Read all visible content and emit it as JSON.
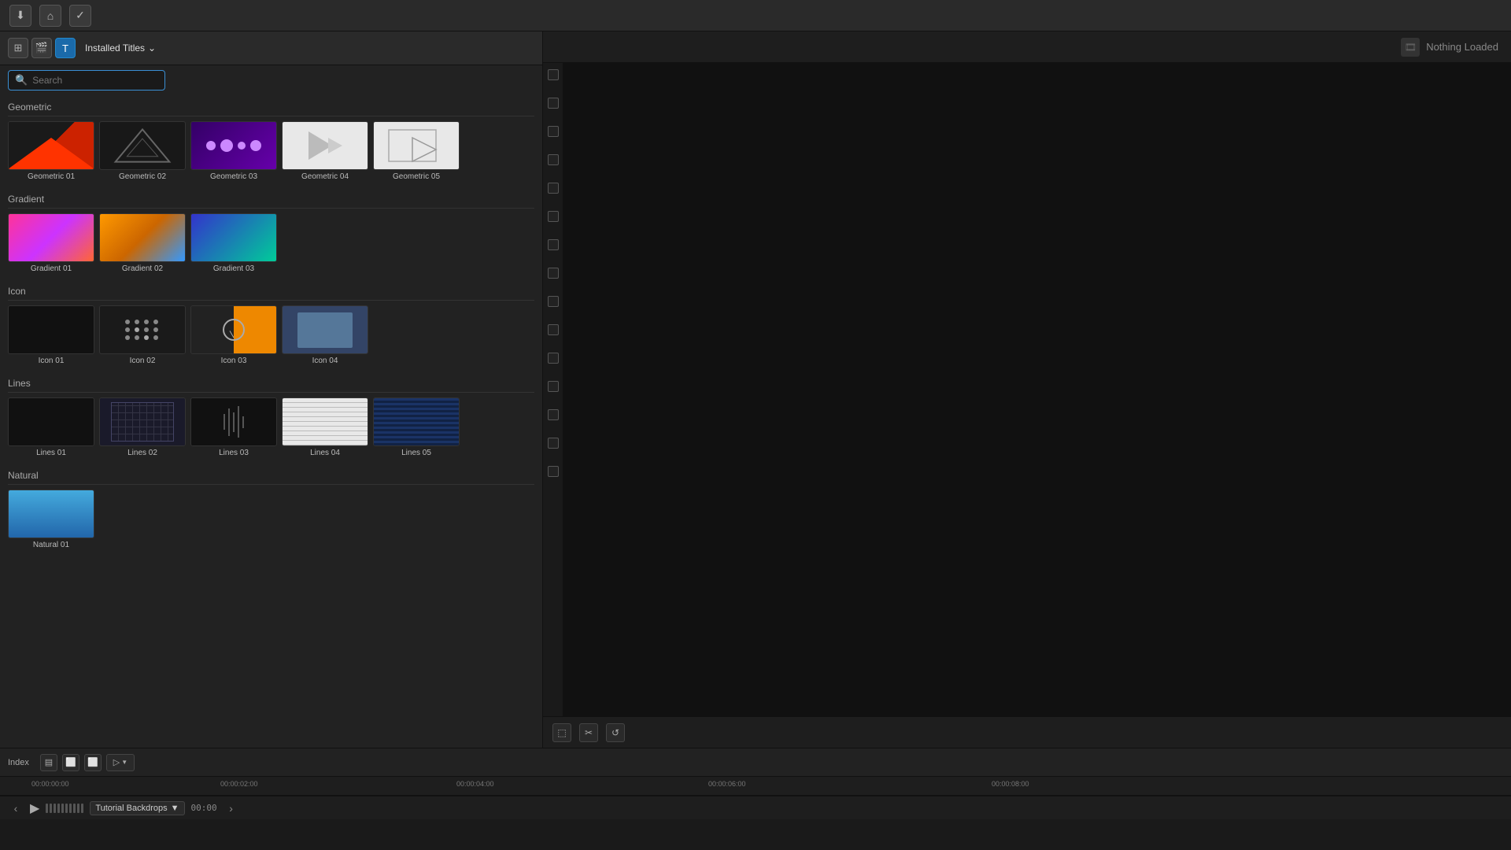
{
  "toolbar": {
    "download_label": "⬇",
    "key_label": "⌘",
    "check_label": "✓"
  },
  "panel": {
    "tab_icons": [
      "⊞",
      "🎬",
      "📁"
    ],
    "installed_titles": "Installed Titles",
    "search_placeholder": "Search"
  },
  "categories": [
    {
      "name": "Geometric",
      "items": [
        {
          "label": "Geometric 01",
          "thumb": "geo01"
        },
        {
          "label": "Geometric 02",
          "thumb": "geo02"
        },
        {
          "label": "Geometric 03",
          "thumb": "geo03"
        },
        {
          "label": "Geometric 04",
          "thumb": "geo04"
        },
        {
          "label": "Geometric 05",
          "thumb": "geo05"
        }
      ]
    },
    {
      "name": "Gradient",
      "items": [
        {
          "label": "Gradient 01",
          "thumb": "grad01"
        },
        {
          "label": "Gradient 02",
          "thumb": "grad02"
        },
        {
          "label": "Gradient 03",
          "thumb": "grad03"
        }
      ]
    },
    {
      "name": "Icon",
      "items": [
        {
          "label": "Icon 01",
          "thumb": "icon01"
        },
        {
          "label": "Icon 02",
          "thumb": "icon02"
        },
        {
          "label": "Icon 03",
          "thumb": "icon03"
        },
        {
          "label": "Icon 04",
          "thumb": "icon04"
        }
      ]
    },
    {
      "name": "Lines",
      "items": [
        {
          "label": "Lines 01",
          "thumb": "lines01"
        },
        {
          "label": "Lines 02",
          "thumb": "lines02"
        },
        {
          "label": "Lines 03",
          "thumb": "lines03"
        },
        {
          "label": "Lines 04",
          "thumb": "lines04"
        },
        {
          "label": "Lines 05",
          "thumb": "lines05"
        }
      ]
    },
    {
      "name": "Natural",
      "items": [
        {
          "label": "Natural 01",
          "thumb": "natural01"
        }
      ]
    }
  ],
  "preview": {
    "nothing_loaded": "Nothing Loaded"
  },
  "timeline": {
    "index_label": "Index",
    "timecode_start": "00:00:00:00",
    "timecode_02": "00:00:02:00",
    "timecode_04": "00:00:04:00",
    "timecode_06": "00:00:06:00",
    "timecode_08": "00:00:08:00",
    "timecode_current": "00:00",
    "project_name": "Tutorial Backdrops"
  }
}
